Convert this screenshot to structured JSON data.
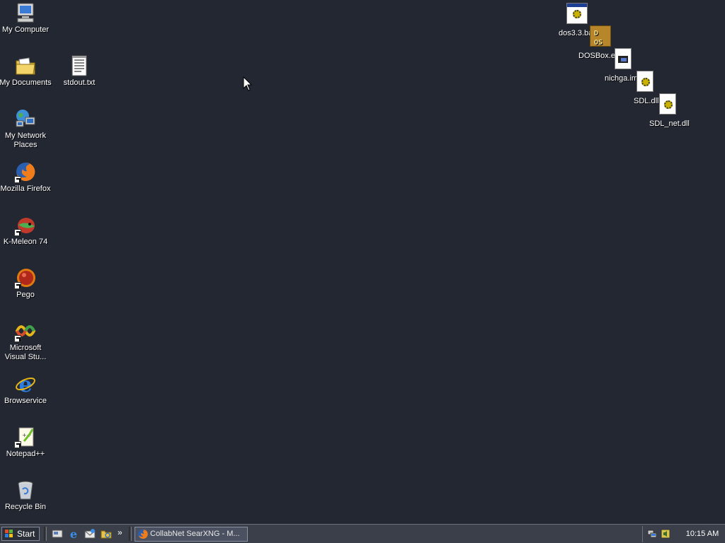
{
  "desktop": {
    "left_icons": [
      {
        "name": "my-computer",
        "label": "My Computer",
        "icon": "my-computer-icon"
      },
      {
        "name": "my-documents",
        "label": "My Documents",
        "icon": "folder-documents-icon"
      },
      {
        "name": "stdout-txt",
        "label": "stdout.txt",
        "icon": "text-file-icon"
      },
      {
        "name": "my-network-places",
        "label": "My Network\nPlaces",
        "icon": "network-icon"
      },
      {
        "name": "mozilla-firefox",
        "label": "Mozilla Firefox",
        "icon": "firefox-icon"
      },
      {
        "name": "k-meleon",
        "label": "K-Meleon 74",
        "icon": "k-meleon-icon"
      },
      {
        "name": "pego",
        "label": "Pego",
        "icon": "pego-icon"
      },
      {
        "name": "microsoft-visual-studio",
        "label": "Microsoft\nVisual Stu...",
        "icon": "visual-studio-icon"
      },
      {
        "name": "browservice",
        "label": "Browservice",
        "icon": "internet-explorer-icon"
      },
      {
        "name": "notepad-plus-plus",
        "label": "Notepad++",
        "icon": "notepad-plus-plus-icon"
      },
      {
        "name": "recycle-bin",
        "label": "Recycle Bin",
        "icon": "recycle-bin-icon"
      }
    ],
    "right_icons": [
      {
        "name": "dos33-bat",
        "label": "dos3.3.bat",
        "icon": "batch-file-icon"
      },
      {
        "name": "dosbox-exe",
        "label": "DOSBox.exe",
        "icon": "dosbox-icon"
      },
      {
        "name": "nichga-img",
        "label": "nichga.img",
        "icon": "image-file-icon"
      },
      {
        "name": "sdl-dll",
        "label": "SDL.dll",
        "icon": "dll-file-icon"
      },
      {
        "name": "sdl-net-dll",
        "label": "SDL_net.dll",
        "icon": "dll-file-icon"
      }
    ]
  },
  "taskbar": {
    "start_label": "Start",
    "quick_launch": [
      "show-desktop-icon",
      "internet-explorer-icon",
      "outlook-express-icon",
      "windows-explorer-icon"
    ],
    "overflow_label": "»",
    "task_item": "CollabNet SearXNG - M...",
    "tray_icons": [
      "network-tray-icon",
      "speaker-tray-icon"
    ],
    "clock": "10:15 AM"
  },
  "colors": {
    "desktop_bg": "#222732",
    "taskbar_bg": "#3a3f49",
    "text": "#ffffff"
  }
}
